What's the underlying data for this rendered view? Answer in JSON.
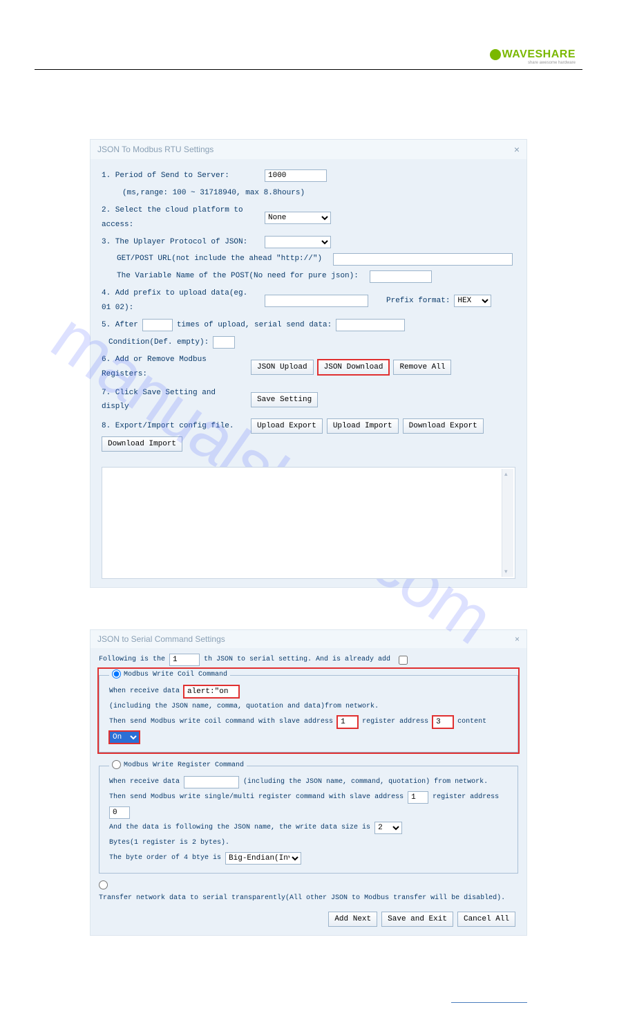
{
  "logo": {
    "text": "WAVESHARE",
    "sub": "share awesome hardware"
  },
  "watermark": "manualshive.com",
  "dialog1": {
    "title": "JSON To Modbus RTU Settings",
    "close": "×",
    "row1": {
      "label": "1. Period of Send to Server:",
      "value": "1000",
      "hint": "(ms,range: 100 ~ 31718940, max 8.8hours)"
    },
    "row2": {
      "label": "2. Select the cloud platform to access:",
      "option": "None"
    },
    "row3": {
      "label": "3. The Uplayer Protocol of JSON:",
      "option": ""
    },
    "row3a": {
      "label": "GET/POST URL(not include the ahead \"http://\")",
      "value": ""
    },
    "row3b": {
      "label": "The Variable Name of the POST(No need for pure json):",
      "value": ""
    },
    "row4": {
      "label": "4. Add prefix to upload data(eg. 01 02):",
      "value": "",
      "suffix_label": "Prefix format:",
      "suffix_option": "HEX"
    },
    "row5": {
      "pre": "5. After",
      "val1": "",
      "mid": "times of upload, serial send data:",
      "val2": "",
      "cond_label": "Condition(Def. empty):",
      "val3": ""
    },
    "row6": {
      "label": "6. Add or Remove Modbus Registers:",
      "b1": "JSON Upload",
      "b2": "JSON Download",
      "b3": "Remove All"
    },
    "row7": {
      "label": "7. Click Save Setting and disply",
      "b": "Save Setting"
    },
    "row8": {
      "label": "8. Export/Import config file.",
      "b1": "Upload Export",
      "b2": "Upload Import",
      "b3": "Download Export",
      "b4": "Download Import"
    }
  },
  "dialog2": {
    "title": "JSON to Serial Command Settings",
    "close": "×",
    "top": {
      "pre": "Following is the",
      "val": "1",
      "mid": "th JSON to serial setting. And is already add"
    },
    "radio_coil": "Modbus Write Coil Command",
    "coil": {
      "l1a": "When receive data",
      "v1": "alert:\"on",
      "l1b": "(including the JSON name, comma, quotation and data)from network.",
      "l2a": "Then send Modbus write coil command with slave address",
      "v2": "1",
      "l2b": "register address",
      "v3": "3",
      "l2c": "content",
      "opt": "On"
    },
    "radio_reg": "Modbus Write Register Command",
    "reg": {
      "l1a": "When receive data",
      "v1": "",
      "l1b": "(including the JSON name, command, quotation) from network.",
      "l2a": "Then send Modbus write single/multi register command with slave address",
      "v2": "1",
      "l2b": "register address",
      "v3": "0",
      "l3a": "And the data is following the JSON name, the write data size is",
      "opt3": "2",
      "l3b": "Bytes(1 register is 2 bytes).",
      "l4a": "The byte order of 4 btye is",
      "opt4": "Big-Endian(Invers"
    },
    "radio_trans": "Transfer network data to serial transparently(All other JSON to Modbus transfer will be disabled).",
    "buttons": {
      "b1": "Add Next",
      "b2": "Save and Exit",
      "b3": "Cancel All"
    }
  }
}
